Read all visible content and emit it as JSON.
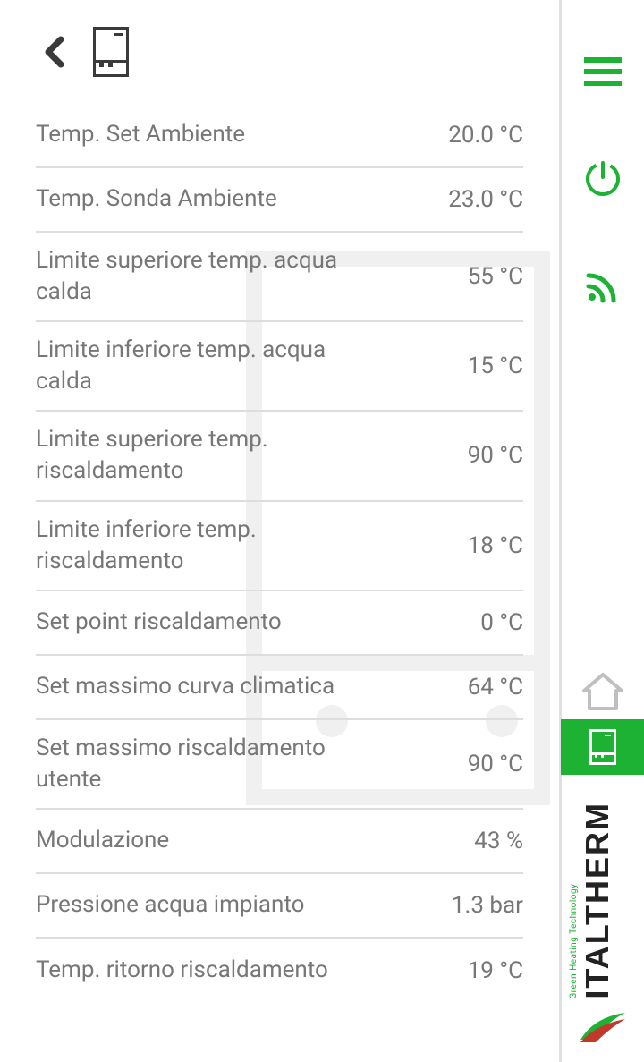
{
  "settings": [
    {
      "label": "Temp. Set Ambiente",
      "value": "20.0 °C"
    },
    {
      "label": "Temp. Sonda Ambiente",
      "value": "23.0 °C"
    },
    {
      "label": "Limite superiore temp. acqua calda",
      "value": "55 °C"
    },
    {
      "label": "Limite inferiore temp. acqua calda",
      "value": "15 °C"
    },
    {
      "label": "Limite superiore temp. riscaldamento",
      "value": "90 °C"
    },
    {
      "label": "Limite inferiore temp. riscaldamento",
      "value": "18 °C"
    },
    {
      "label": "Set point riscaldamento",
      "value": "0 °C"
    },
    {
      "label": "Set massimo curva climatica",
      "value": "64 °C"
    },
    {
      "label": "Set massimo riscaldamento utente",
      "value": "90 °C"
    },
    {
      "label": "Modulazione",
      "value": "43 %"
    },
    {
      "label": "Pressione acqua impianto",
      "value": "1.3 bar"
    },
    {
      "label": "Temp. ritorno riscaldamento",
      "value": "19 °C"
    }
  ],
  "brand": {
    "name": "ITALTHERM",
    "tagline": "Green Heating Technology"
  }
}
